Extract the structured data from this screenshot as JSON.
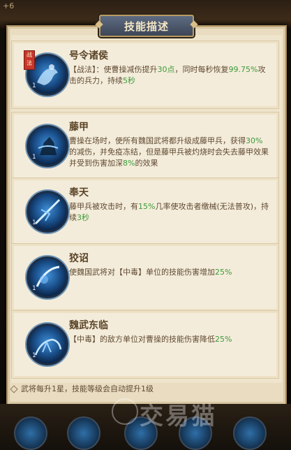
{
  "header": {
    "corner_value": "+6"
  },
  "dialog": {
    "title": "技能描述"
  },
  "skills": [
    {
      "tag": "战法",
      "name": "号令诸侯",
      "level": "1",
      "desc_parts": [
        "【战法】：使曹操减伤提升",
        "30点",
        "，同时每秒恢复",
        "99.75%",
        "攻击的兵力，持续",
        "5秒"
      ]
    },
    {
      "tag": "",
      "name": "藤甲",
      "level": "1",
      "desc_parts": [
        "曹操在场时，使所有魏国武将都升级成藤甲兵，获得",
        "30%",
        "的减伤，并免疫冻结，但是藤甲兵被灼烧时会失去藤甲效果并受到伤害加深",
        "8%",
        "的效果"
      ]
    },
    {
      "tag": "",
      "name": "奉天",
      "level": "1",
      "desc_parts": [
        "藤甲兵被攻击时，有",
        "15%",
        "几率使攻击者缴械(无法普攻)，持续",
        "3秒",
        ""
      ]
    },
    {
      "tag": "",
      "name": "狡诏",
      "level": "1",
      "desc_parts": [
        "使魏国武将对【中毒】单位的技能伤害增加",
        "25%",
        "",
        "",
        ""
      ]
    },
    {
      "tag": "",
      "name": "魏武东临",
      "level": "1",
      "desc_parts": [
        "【中毒】的敌方单位对曹操的技能伤害降低",
        "25%",
        "",
        "",
        ""
      ]
    }
  ],
  "footer": {
    "text": "武将每升1星，技能等级会自动提升1级"
  },
  "watermark": {
    "text": "交易猫"
  },
  "colors": {
    "highlight": "#3d9a3a",
    "text": "#5f4a32",
    "panel": "#efe4cc"
  }
}
